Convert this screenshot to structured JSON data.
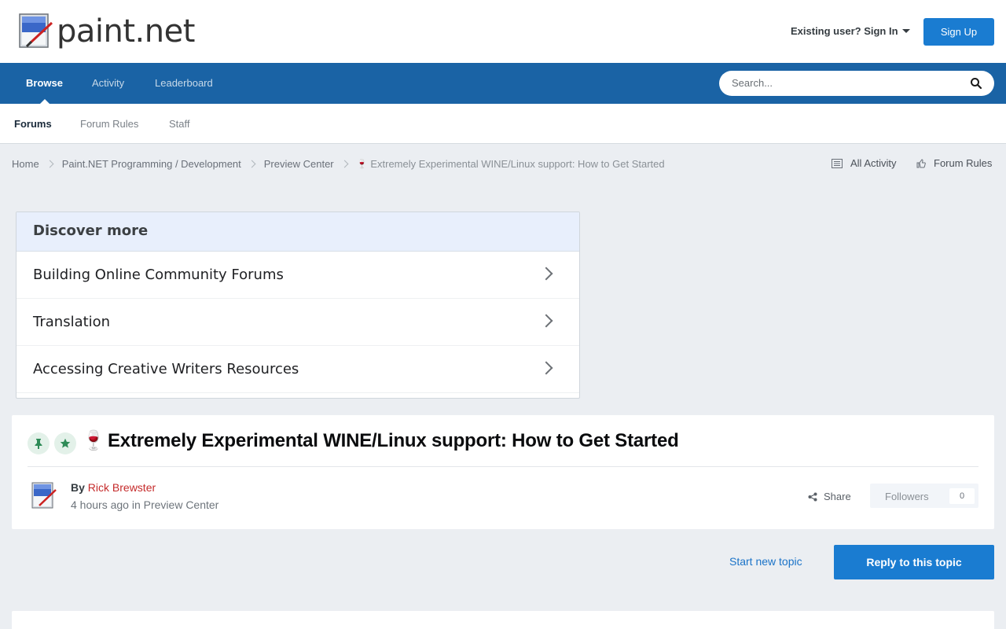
{
  "header": {
    "logo_text": "paint.net",
    "signin_label": "Existing user? Sign In",
    "signup_label": "Sign Up"
  },
  "nav": {
    "items": [
      {
        "label": "Browse",
        "active": true
      },
      {
        "label": "Activity",
        "active": false
      },
      {
        "label": "Leaderboard",
        "active": false
      }
    ],
    "search_placeholder": "Search..."
  },
  "subnav": {
    "items": [
      {
        "label": "Forums",
        "active": true
      },
      {
        "label": "Forum Rules",
        "active": false
      },
      {
        "label": "Staff",
        "active": false
      }
    ]
  },
  "breadcrumb": {
    "items": [
      "Home",
      "Paint.NET Programming / Development",
      "Preview Center"
    ],
    "current": "Extremely Experimental WINE/Linux support: How to Get Started",
    "right_links": [
      "All Activity",
      "Forum Rules"
    ]
  },
  "discover": {
    "title": "Discover more",
    "items": [
      "Building Online Community Forums",
      "Translation",
      "Accessing Creative Writers Resources"
    ]
  },
  "topic": {
    "emoji": "🍷",
    "title": "Extremely Experimental WINE/Linux support: How to Get Started",
    "by_label": "By",
    "author": "Rick Brewster",
    "time": "4 hours ago",
    "in_label": "in",
    "forum": "Preview Center",
    "share_label": "Share",
    "followers_label": "Followers",
    "followers_count": "0"
  },
  "actions": {
    "start_topic": "Start new topic",
    "reply": "Reply to this topic"
  },
  "colors": {
    "nav_bg": "#1a63a5",
    "button_blue": "#1a7cd1",
    "author_red": "#c52b2b",
    "badge_green": "#2e8b57"
  }
}
